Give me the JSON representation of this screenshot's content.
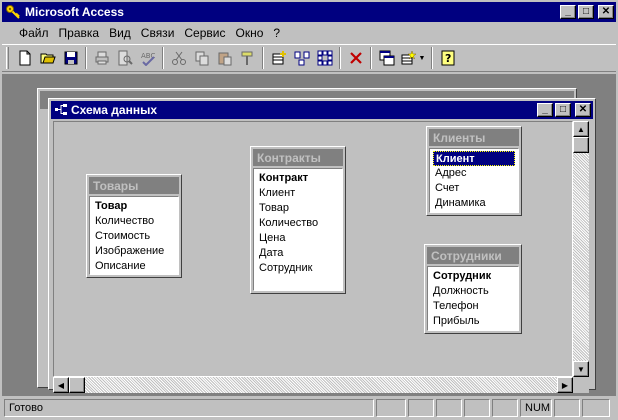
{
  "app": {
    "title": "Microsoft Access"
  },
  "window_buttons": {
    "minimize": "_",
    "maximize": "□",
    "close": "✕"
  },
  "menu": [
    {
      "label": "Файл"
    },
    {
      "label": "Правка"
    },
    {
      "label": "Вид"
    },
    {
      "label": "Связи"
    },
    {
      "label": "Сервис"
    },
    {
      "label": "Окно"
    },
    {
      "label": "?"
    }
  ],
  "toolbar": {
    "buttons": [
      {
        "name": "new-icon",
        "enabled": true
      },
      {
        "name": "open-folder-icon",
        "enabled": true
      },
      {
        "name": "save-icon",
        "enabled": true
      },
      {
        "name": "print-icon",
        "enabled": false
      },
      {
        "name": "print-preview-icon",
        "enabled": false
      },
      {
        "name": "spelling-icon",
        "enabled": false
      },
      {
        "name": "cut-icon",
        "enabled": false
      },
      {
        "name": "copy-icon",
        "enabled": false
      },
      {
        "name": "paste-icon",
        "enabled": false
      },
      {
        "name": "format-painter-icon",
        "enabled": false
      },
      {
        "name": "show-table-icon",
        "enabled": true
      },
      {
        "name": "show-direct-icon",
        "enabled": true
      },
      {
        "name": "show-all-icon",
        "enabled": true
      },
      {
        "name": "delete-icon",
        "enabled": true
      },
      {
        "name": "database-window-icon",
        "enabled": true
      },
      {
        "name": "new-object-icon",
        "enabled": true
      },
      {
        "name": "help-icon",
        "enabled": true
      }
    ]
  },
  "schema_window": {
    "title": "Схема данных"
  },
  "tables": [
    {
      "id": "tovary",
      "title": "Товары",
      "fields": [
        {
          "label": "Товар",
          "key": true
        },
        {
          "label": "Количество"
        },
        {
          "label": "Стоимость"
        },
        {
          "label": "Изображение"
        },
        {
          "label": "Описание"
        }
      ]
    },
    {
      "id": "kontrakty",
      "title": "Контракты",
      "fields": [
        {
          "label": "Контракт",
          "key": true
        },
        {
          "label": "Клиент"
        },
        {
          "label": "Товар"
        },
        {
          "label": "Количество"
        },
        {
          "label": "Цена"
        },
        {
          "label": "Дата"
        },
        {
          "label": "Сотрудник"
        }
      ]
    },
    {
      "id": "klienty",
      "title": "Клиенты",
      "fields": [
        {
          "label": "Клиент",
          "key": true,
          "selected": true
        },
        {
          "label": "Адрес"
        },
        {
          "label": "Счет"
        },
        {
          "label": "Динамика"
        }
      ]
    },
    {
      "id": "sotrudniki",
      "title": "Сотрудники",
      "fields": [
        {
          "label": "Сотрудник",
          "key": true
        },
        {
          "label": "Должность"
        },
        {
          "label": "Телефон"
        },
        {
          "label": "Прибыль"
        }
      ]
    }
  ],
  "status": {
    "message": "Готово",
    "num_indicator": "NUM"
  }
}
